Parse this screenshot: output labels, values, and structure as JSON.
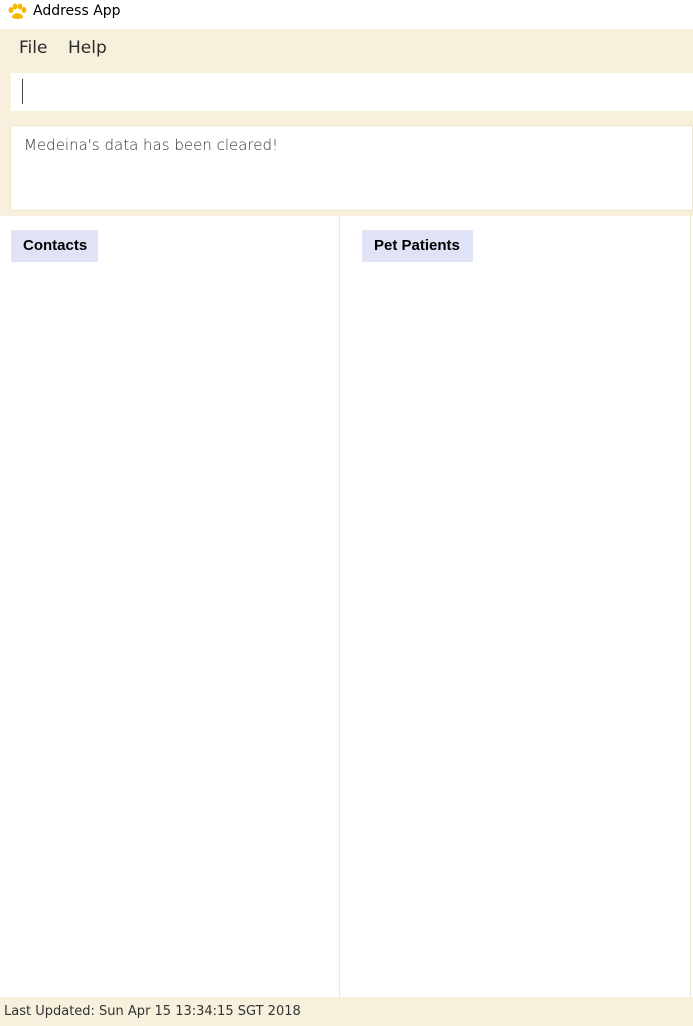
{
  "window": {
    "title": "Address App",
    "icon": "paw-icon",
    "accent_color": "#f5b800"
  },
  "menu": {
    "file_label": "File",
    "help_label": "Help"
  },
  "command": {
    "value": "",
    "placeholder": ""
  },
  "result": {
    "message": "Medeina's data has been cleared!"
  },
  "panels": {
    "contacts_label": "Contacts",
    "pets_label": "Pet Patients"
  },
  "status": {
    "last_updated": "Last Updated: Sun Apr 15 13:34:15 SGT 2018"
  },
  "colors": {
    "panel_bg": "#f7f0dc",
    "header_bg": "#dfe3f5"
  }
}
